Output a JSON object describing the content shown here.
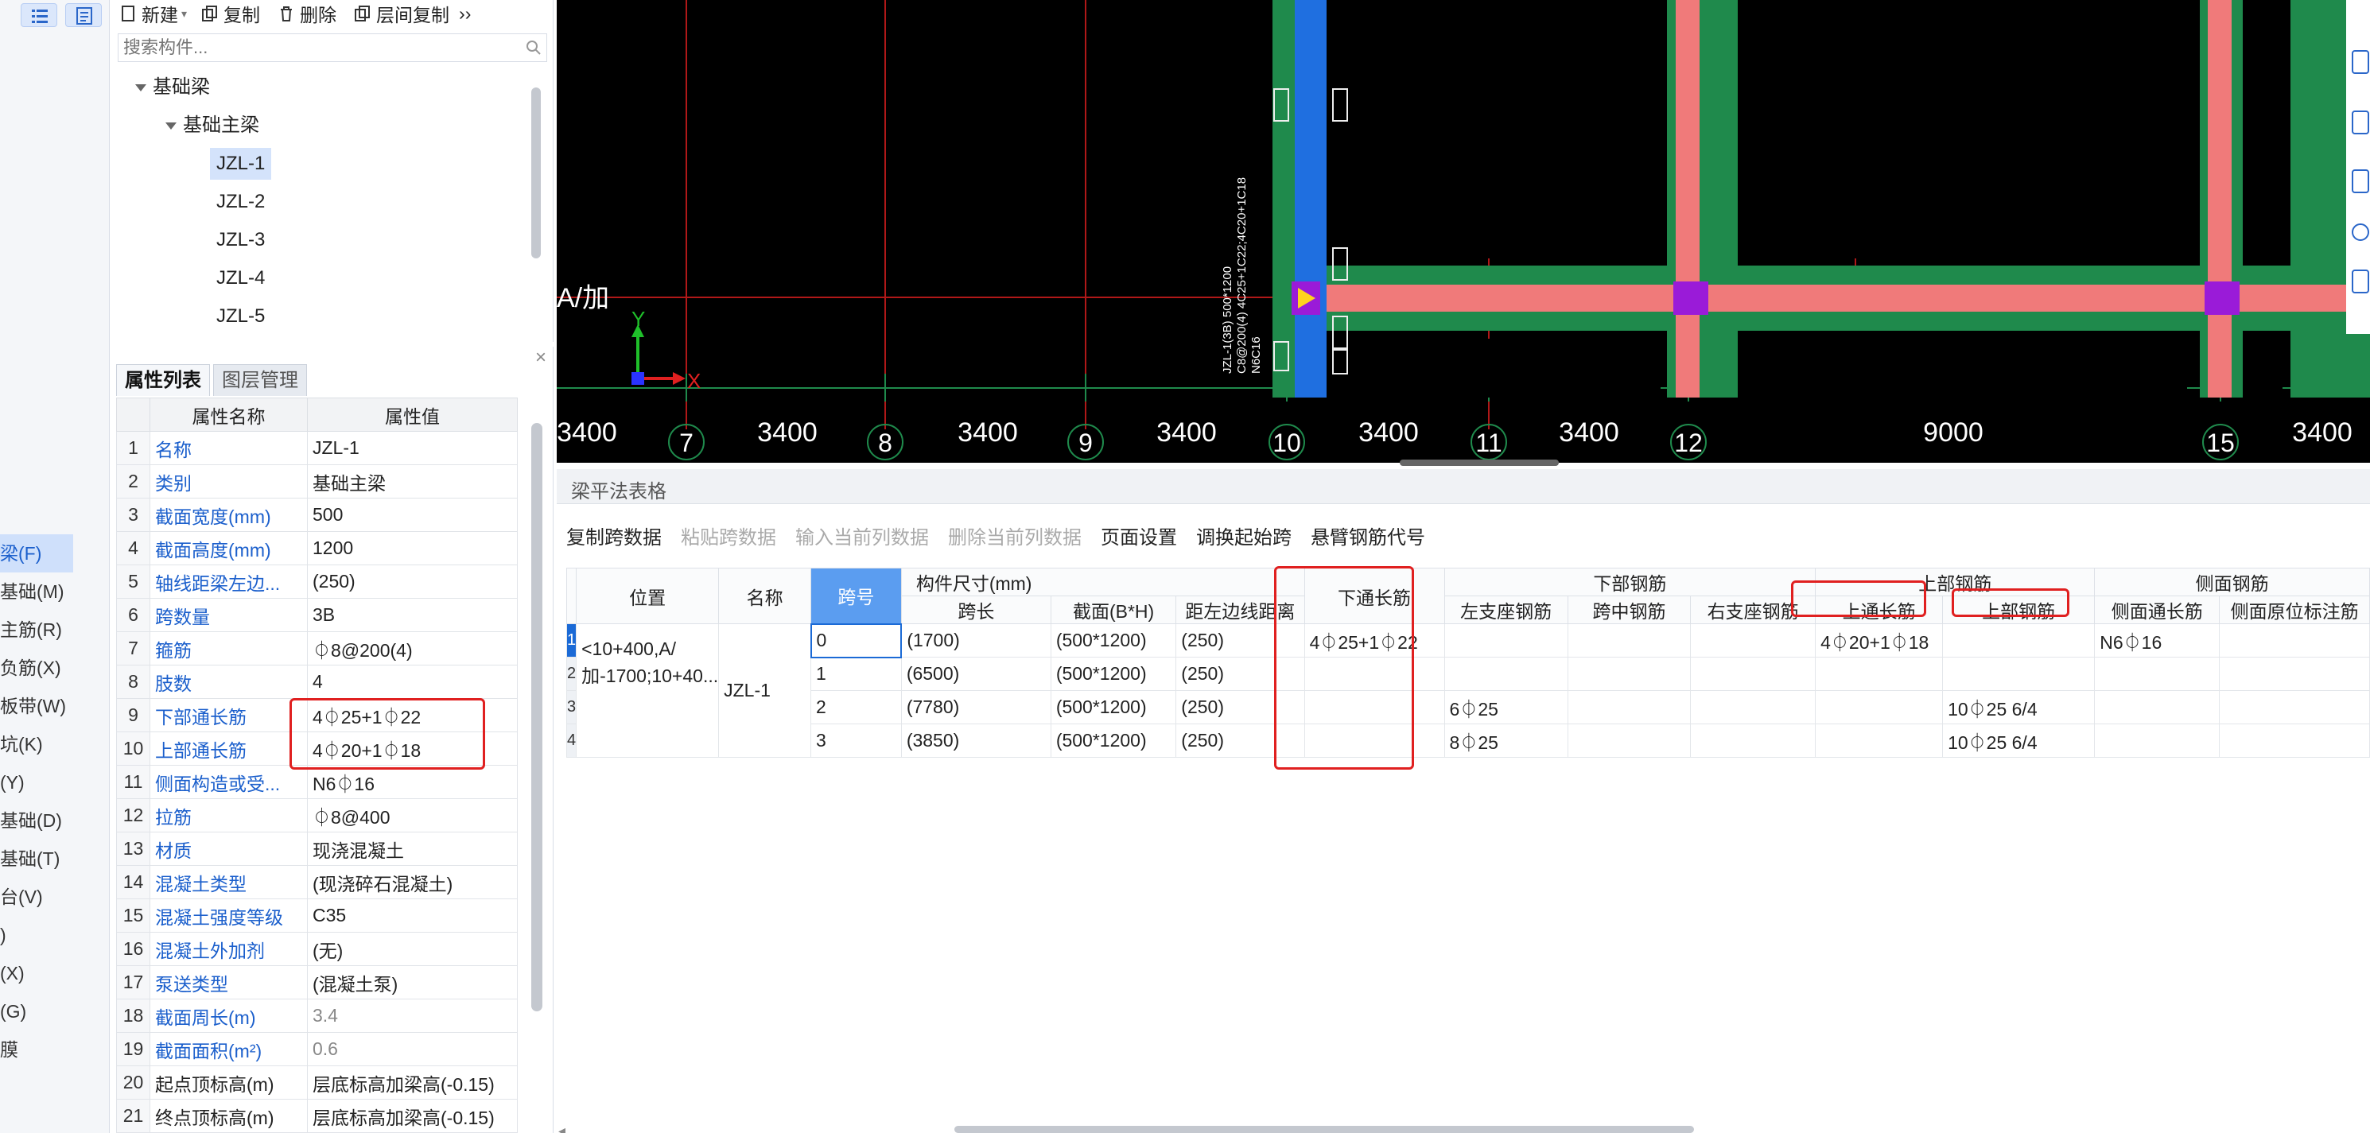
{
  "toolbar": {
    "new_label": "新建",
    "copy_label": "复制",
    "delete_label": "删除",
    "floor_copy_label": "层间复制",
    "more_label": "››"
  },
  "search": {
    "placeholder": "搜索构件..."
  },
  "tree": {
    "root": "基础梁",
    "child": "基础主梁",
    "leaves": [
      "JZL-1",
      "JZL-2",
      "JZL-3",
      "JZL-4",
      "JZL-5"
    ],
    "selected": "JZL-1"
  },
  "left_nav": {
    "items": [
      "梁(F)",
      "基础(M)",
      "主筋(R)",
      "负筋(X)",
      "板带(W)",
      "坑(K)",
      "(Y)",
      "基础(D)",
      "基础(T)",
      "台(V)",
      ")",
      "(X)",
      "(G)",
      "膜"
    ],
    "active": "梁(F)"
  },
  "props": {
    "close_label": "×",
    "tabs": [
      "属性列表",
      "图层管理"
    ],
    "header": [
      "属性名称",
      "属性值"
    ],
    "rows": [
      {
        "no": "1",
        "name": "名称",
        "value": "JZL-1"
      },
      {
        "no": "2",
        "name": "类别",
        "value": "基础主梁"
      },
      {
        "no": "3",
        "name": "截面宽度(mm)",
        "value": "500"
      },
      {
        "no": "4",
        "name": "截面高度(mm)",
        "value": "1200"
      },
      {
        "no": "5",
        "name": "轴线距梁左边...",
        "value": "(250)"
      },
      {
        "no": "6",
        "name": "跨数量",
        "value": "3B"
      },
      {
        "no": "7",
        "name": "箍筋",
        "value": "⏀8@200(4)"
      },
      {
        "no": "8",
        "name": "肢数",
        "value": "4"
      },
      {
        "no": "9",
        "name": "下部通长筋",
        "value": "4⏀25+1⏀22"
      },
      {
        "no": "10",
        "name": "上部通长筋",
        "value": "4⏀20+1⏀18"
      },
      {
        "no": "11",
        "name": "侧面构造或受...",
        "value": "N6⏀16"
      },
      {
        "no": "12",
        "name": "拉筋",
        "value": "⏀8@400"
      },
      {
        "no": "13",
        "name": "材质",
        "value": "现浇混凝土"
      },
      {
        "no": "14",
        "name": "混凝土类型",
        "value": "(现浇碎石混凝土)"
      },
      {
        "no": "15",
        "name": "混凝土强度等级",
        "value": "C35"
      },
      {
        "no": "16",
        "name": "混凝土外加剂",
        "value": "(无)"
      },
      {
        "no": "17",
        "name": "泵送类型",
        "value": "(混凝土泵)"
      },
      {
        "no": "18",
        "name": "截面周长(m)",
        "value": "3.4"
      },
      {
        "no": "19",
        "name": "截面面积(m²)",
        "value": "0.6"
      },
      {
        "no": "20",
        "name": "起点顶标高(m)",
        "value": "层底标高加梁高(-0.15)"
      },
      {
        "no": "21",
        "name": "终点顶标高(m)",
        "value": "层底标高加梁高(-0.15)"
      }
    ]
  },
  "canvas": {
    "axis_label_a": "A/加",
    "axis_x": "X",
    "axis_y": "Y",
    "dims": [
      "3400",
      "3400",
      "3400",
      "3400",
      "3400",
      "3400",
      "9000",
      "3400"
    ],
    "grid_numbers": [
      "7",
      "8",
      "9",
      "10",
      "11",
      "12",
      "15"
    ],
    "beam_text_1": "JZL-1(3B) 500*1200",
    "beam_text_2": "C8@200(4) 4C25+1C22;4C20+1C18",
    "beam_text_3": "N6C16"
  },
  "beam_table": {
    "title": "梁平法表格",
    "toolbar": [
      {
        "label": "复制跨数据",
        "enabled": true
      },
      {
        "label": "粘贴跨数据",
        "enabled": false
      },
      {
        "label": "输入当前列数据",
        "enabled": false
      },
      {
        "label": "删除当前列数据",
        "enabled": false
      },
      {
        "label": "页面设置",
        "enabled": true
      },
      {
        "label": "调换起始跨",
        "enabled": true
      },
      {
        "label": "悬臂钢筋代号",
        "enabled": true
      }
    ],
    "headers": {
      "position": "位置",
      "name": "名称",
      "span_no": "跨号",
      "size_group": "构件尺寸(mm)",
      "span_len": "跨长",
      "section": "截面(B*H)",
      "left_dist": "距左边线距离",
      "bottom_through": "下通长筋",
      "bottom_group": "下部钢筋",
      "left_seat": "左支座钢筋",
      "mid": "跨中钢筋",
      "right_seat": "右支座钢筋",
      "top_group": "上部钢筋",
      "top_through": "上通长筋",
      "top_bar": "上部钢筋",
      "side_group": "侧面钢筋",
      "side_through": "侧面通长筋",
      "side_orig": "侧面原位标注筋"
    },
    "row_numbers": [
      "1",
      "2",
      "3",
      "4"
    ],
    "position_text": "<10+400,A/加-1700;10+40...",
    "name_text": "JZL-1",
    "rows": [
      {
        "span": "0",
        "len": "(1700)",
        "sec": "(500*1200)",
        "dist": "(250)",
        "bot_through": "4⏀25+1⏀22",
        "left_seat": "",
        "mid": "",
        "right_seat": "",
        "top_through": "4⏀20+1⏀18",
        "top_bar": "",
        "side_through": "N6⏀16",
        "side_orig": ""
      },
      {
        "span": "1",
        "len": "(6500)",
        "sec": "(500*1200)",
        "dist": "(250)",
        "bot_through": "",
        "left_seat": "",
        "mid": "",
        "right_seat": "",
        "top_through": "",
        "top_bar": "",
        "side_through": "",
        "side_orig": ""
      },
      {
        "span": "2",
        "len": "(7780)",
        "sec": "(500*1200)",
        "dist": "(250)",
        "bot_through": "",
        "left_seat": "6⏀25",
        "mid": "",
        "right_seat": "",
        "top_through": "",
        "top_bar": "10⏀25 6/4",
        "side_through": "",
        "side_orig": ""
      },
      {
        "span": "3",
        "len": "(3850)",
        "sec": "(500*1200)",
        "dist": "(250)",
        "bot_through": "",
        "left_seat": "8⏀25",
        "mid": "",
        "right_seat": "",
        "top_through": "",
        "top_bar": "10⏀25 6/4",
        "side_through": "",
        "side_orig": ""
      }
    ]
  },
  "colors": {
    "highlight_red": "#e02020",
    "beam_green": "#1f8a4c",
    "beam_pink": "#f07a7a",
    "column_purple": "#9a1bd8",
    "selected_blue": "#1f6fe0"
  }
}
